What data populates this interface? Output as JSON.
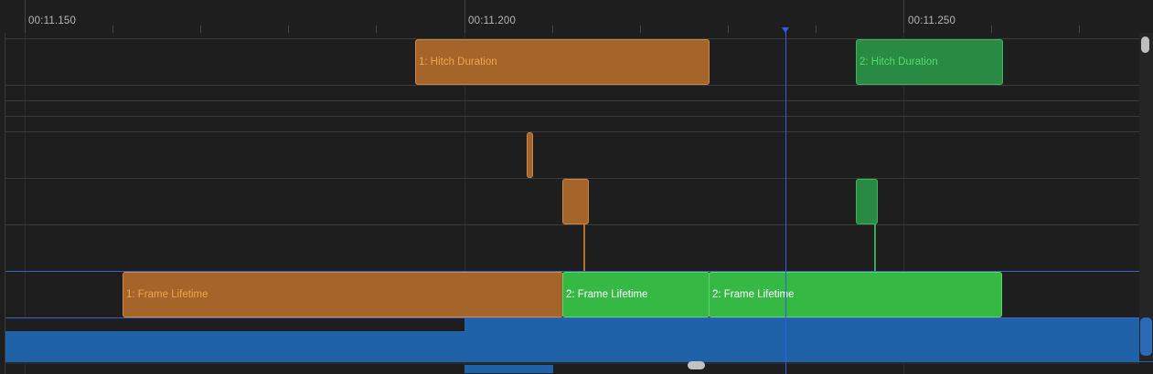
{
  "ruler": {
    "ticks": [
      "00:11.150",
      "00:11.200",
      "00:11.250"
    ]
  },
  "tracks": {
    "hitch_1": {
      "label": "1: Hitch Duration",
      "color": "#a5642a"
    },
    "hitch_2": {
      "label": "2: Hitch Duration",
      "color": "#288a43"
    },
    "frame_1": {
      "label": "1: Frame Lifetime",
      "color": "#a5642a"
    },
    "frame_2a": {
      "label": "2: Frame Lifetime",
      "color": "#35b944"
    },
    "frame_2b": {
      "label": "2: Frame Lifetime",
      "color": "#35b944"
    }
  },
  "colors": {
    "background": "#1e1e1e",
    "playhead": "#2f5fe0",
    "selection": "#2062a8"
  }
}
